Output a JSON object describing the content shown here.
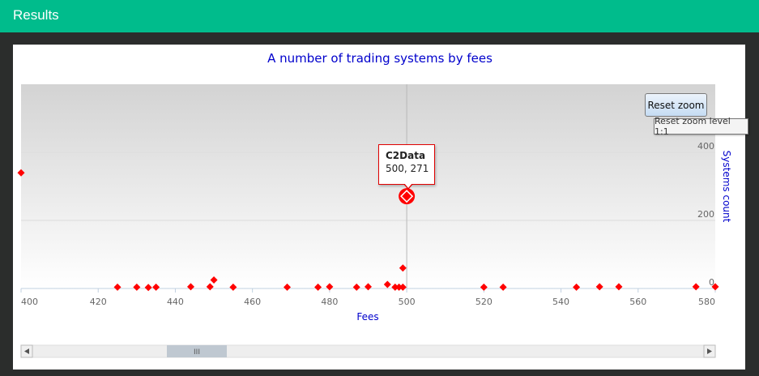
{
  "header": {
    "title": "Results"
  },
  "buttons": {
    "reset_zoom": "Reset zoom",
    "reset_zoom_tooltip": "Reset zoom level 1:1"
  },
  "tooltip": {
    "series": "C2Data",
    "value": "500, 271"
  },
  "scrollbar": {
    "grip": "III"
  },
  "colors": {
    "header": "#00bc8c",
    "marker": "#ff0000",
    "title": "#0000cc"
  },
  "chart_data": {
    "type": "scatter",
    "title": "A number of trading systems by fees",
    "xlabel": "Fees",
    "ylabel": "Systems count",
    "xlim": [
      400,
      580
    ],
    "ylim": [
      0,
      600
    ],
    "x_ticks": [
      400,
      420,
      440,
      460,
      480,
      500,
      520,
      540,
      560,
      580
    ],
    "y_ticks": [
      0,
      200,
      400
    ],
    "y_axis_side": "right",
    "grid": true,
    "highlighted_point": {
      "x": 500,
      "y": 271
    },
    "series": [
      {
        "name": "C2Data",
        "points": [
          [
            400,
            340
          ],
          [
            425,
            4
          ],
          [
            430,
            4
          ],
          [
            433,
            3
          ],
          [
            435,
            4
          ],
          [
            444,
            5
          ],
          [
            449,
            5
          ],
          [
            450,
            25
          ],
          [
            455,
            4
          ],
          [
            469,
            4
          ],
          [
            477,
            4
          ],
          [
            480,
            5
          ],
          [
            487,
            4
          ],
          [
            490,
            5
          ],
          [
            495,
            12
          ],
          [
            497,
            4
          ],
          [
            498,
            4
          ],
          [
            499,
            4
          ],
          [
            499,
            60
          ],
          [
            500,
            271
          ],
          [
            520,
            4
          ],
          [
            525,
            4
          ],
          [
            544,
            4
          ],
          [
            550,
            5
          ],
          [
            555,
            5
          ],
          [
            575,
            5
          ],
          [
            580,
            5
          ]
        ]
      }
    ]
  }
}
